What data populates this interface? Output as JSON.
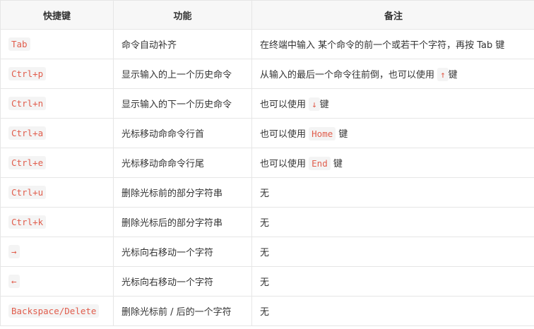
{
  "headers": [
    "快捷键",
    "功能",
    "备注"
  ],
  "rows": [
    {
      "key": "Tab",
      "func": "命令自动补齐",
      "note": [
        {
          "t": "在终端中输入 某个命令的前一个或若干个字符，再按 Tab 键"
        }
      ]
    },
    {
      "key": "Ctrl+p",
      "func": "显示输入的上一个历史命令",
      "note": [
        {
          "t": "从输入的最后一个命令往前倒，也可以使用 "
        },
        {
          "c": "↑"
        },
        {
          "t": "键"
        }
      ]
    },
    {
      "key": "Ctrl+n",
      "func": "显示输入的下一个历史命令",
      "note": [
        {
          "t": "也可以使用 "
        },
        {
          "c": "↓"
        },
        {
          "t": "键"
        }
      ]
    },
    {
      "key": "Ctrl+a",
      "func": "光标移动命命令行首",
      "note": [
        {
          "t": "也可以使用 "
        },
        {
          "c": "Home"
        },
        {
          "t": " 键"
        }
      ]
    },
    {
      "key": "Ctrl+e",
      "func": "光标移动命命令行尾",
      "note": [
        {
          "t": "也可以使用 "
        },
        {
          "c": "End"
        },
        {
          "t": " 键"
        }
      ]
    },
    {
      "key": "Ctrl+u",
      "func": "删除光标前的部分字符串",
      "note": [
        {
          "t": "无"
        }
      ]
    },
    {
      "key": "Ctrl+k",
      "func": "删除光标后的部分字符串",
      "note": [
        {
          "t": "无"
        }
      ]
    },
    {
      "key": "→",
      "func": "光标向右移动一个字符",
      "note": [
        {
          "t": "无"
        }
      ]
    },
    {
      "key": "←",
      "func": "光标向右移动一个字符",
      "note": [
        {
          "t": "无"
        }
      ]
    },
    {
      "key": "Backspace/Delete",
      "func": "删除光标前 / 后的一个字符",
      "note": [
        {
          "t": "无"
        }
      ]
    }
  ]
}
